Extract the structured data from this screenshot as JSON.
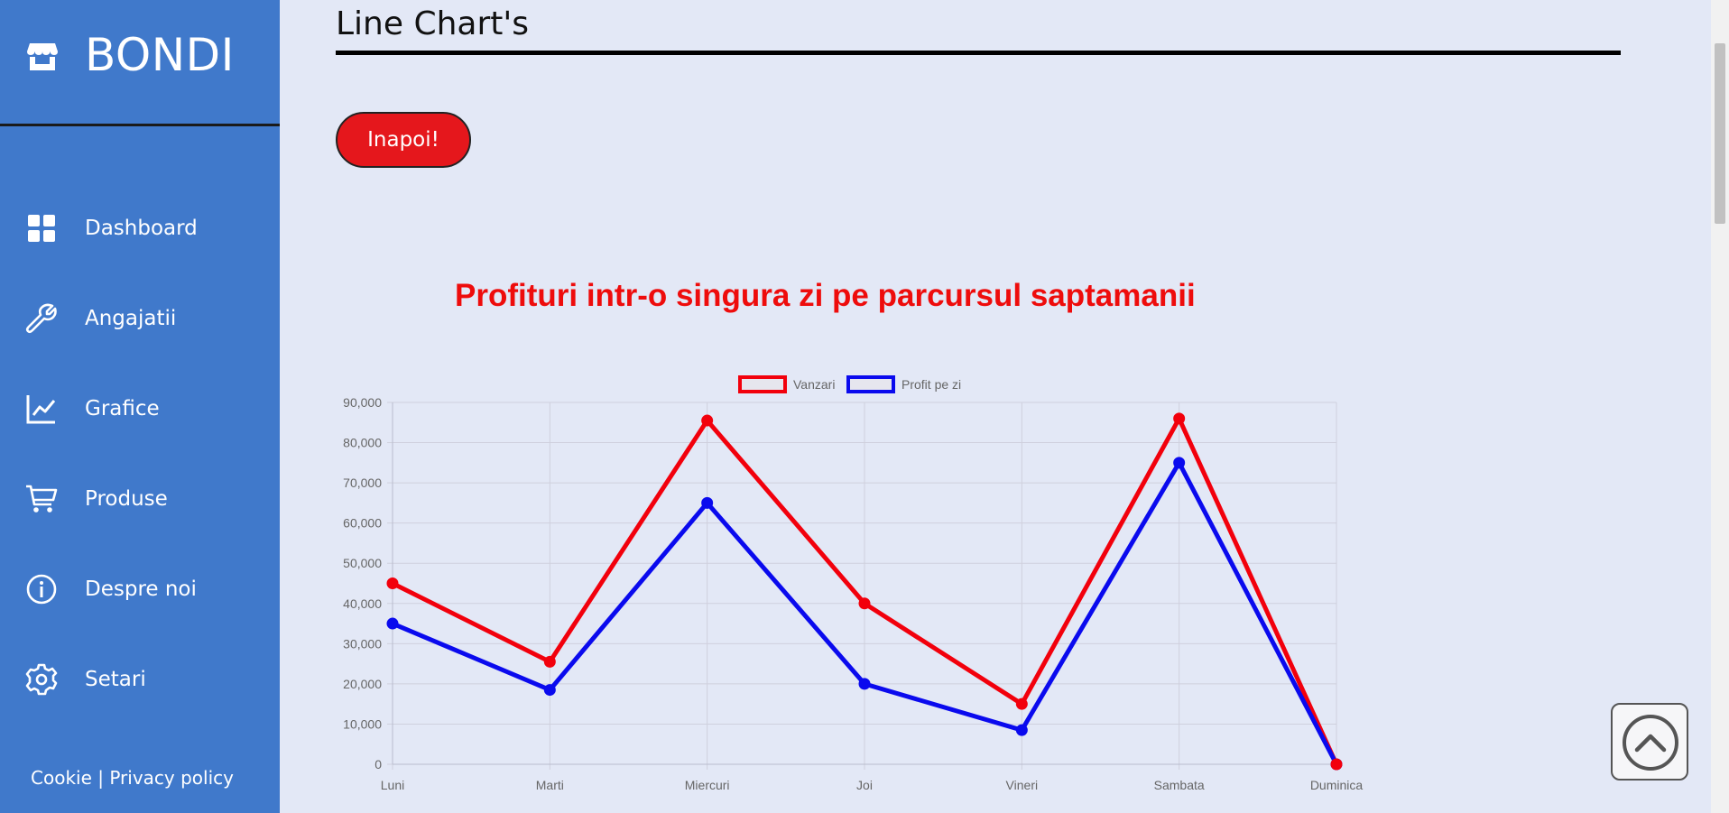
{
  "sidebar": {
    "brand": "BONDI",
    "brand_icon": "store-icon",
    "items": [
      {
        "label": "Dashboard",
        "icon": "grid-icon"
      },
      {
        "label": "Angajatii",
        "icon": "wrench-icon"
      },
      {
        "label": "Grafice",
        "icon": "line-chart-icon"
      },
      {
        "label": "Produse",
        "icon": "cart-icon"
      },
      {
        "label": "Despre noi",
        "icon": "info-icon"
      },
      {
        "label": "Setari",
        "icon": "gear-icon"
      }
    ],
    "footer": {
      "cookie": "Cookie",
      "separator": " | ",
      "privacy": "Privacy policy"
    }
  },
  "main": {
    "page_title": "Line Chart's",
    "back_button": "Inapoi!",
    "chart_heading": "Profituri intr-o singura zi pe parcursul saptamanii"
  },
  "colors": {
    "sidebar_bg": "#4079cb",
    "page_bg": "#e3e8f6",
    "accent_red": "#e5171c",
    "series_red": "#f2000c",
    "series_blue": "#0a0aee"
  },
  "chart_data": {
    "type": "line",
    "title": "",
    "xlabel": "",
    "ylabel": "",
    "categories": [
      "Luni",
      "Marti",
      "Miercuri",
      "Joi",
      "Vineri",
      "Sambata",
      "Duminica"
    ],
    "series": [
      {
        "name": "Vanzari",
        "color": "#f2000c",
        "values": [
          45000,
          25500,
          85500,
          40000,
          15000,
          86000,
          0
        ]
      },
      {
        "name": "Profit pe zi",
        "color": "#0a0aee",
        "values": [
          35000,
          18500,
          65000,
          20000,
          8500,
          75000,
          0
        ]
      }
    ],
    "ylim": [
      0,
      90000
    ],
    "yticks": [
      "0",
      "10,000",
      "20,000",
      "30,000",
      "40,000",
      "50,000",
      "60,000",
      "70,000",
      "80,000",
      "90,000"
    ],
    "grid": true,
    "legend_position": "top"
  },
  "scroll_top_icon": "chevron-up-circle-icon"
}
